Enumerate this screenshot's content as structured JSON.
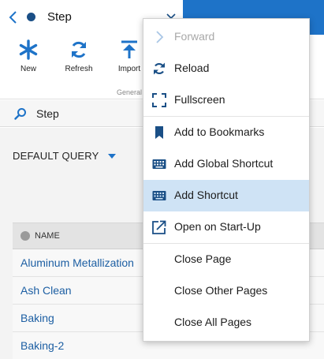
{
  "header": {
    "title": "Step"
  },
  "ribbon": {
    "buttons": [
      {
        "label": "New"
      },
      {
        "label": "Refresh"
      },
      {
        "label": "Import"
      }
    ],
    "group_label": "General"
  },
  "search": {
    "value": "Step"
  },
  "query": {
    "label": "DEFAULT QUERY"
  },
  "table": {
    "column_header": "NAME",
    "rows": [
      "Aluminum Metallization",
      "Ash Clean",
      "Baking",
      "Baking-2"
    ]
  },
  "context_menu": {
    "items": [
      {
        "label": "Forward",
        "icon": "chevron-right-icon",
        "disabled": true
      },
      {
        "label": "Reload",
        "icon": "reload-icon"
      },
      {
        "label": "Fullscreen",
        "icon": "fullscreen-icon"
      },
      {
        "label": "Add to Bookmarks",
        "icon": "bookmark-icon"
      },
      {
        "label": "Add Global Shortcut",
        "icon": "keyboard-icon"
      },
      {
        "label": "Add Shortcut",
        "icon": "keyboard-icon",
        "active": true
      },
      {
        "label": "Open on Start-Up",
        "icon": "open-external-icon"
      },
      {
        "label": "Close Page"
      },
      {
        "label": "Close Other Pages"
      },
      {
        "label": "Close All Pages"
      }
    ]
  },
  "colors": {
    "accent": "#1e73c8",
    "link": "#1d5fa3",
    "active_item": "#cfe3f5"
  }
}
